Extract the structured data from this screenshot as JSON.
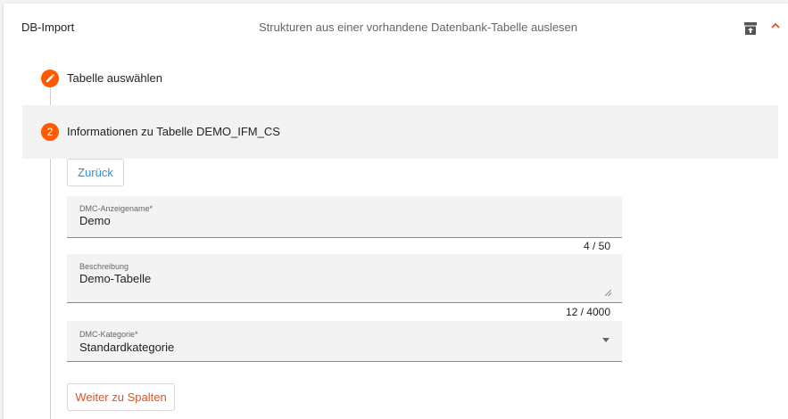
{
  "header": {
    "title": "DB-Import",
    "description": "Strukturen aus einer vorhandene Datenbank-Tabelle auslesen",
    "icons": [
      "archive-icon",
      "chevron-up-icon"
    ],
    "accent_color": "#ff5a00"
  },
  "steps": [
    {
      "badge_icon": "pencil-icon",
      "label": "Tabelle auswählen"
    },
    {
      "number": "2",
      "label": "Informationen zu Tabelle DEMO_IFM_CS"
    }
  ],
  "buttons": {
    "back": "Zurück",
    "next": "Weiter zu Spalten"
  },
  "form": {
    "display_name": {
      "label": "DMC-Anzeigename*",
      "value": "Demo",
      "counter": "4 / 50"
    },
    "description": {
      "label": "Beschreibung",
      "value": "Demo-Tabelle",
      "counter": "12 / 4000"
    },
    "category": {
      "label": "DMC-Kategorie*",
      "value": "Standardkategorie"
    }
  }
}
